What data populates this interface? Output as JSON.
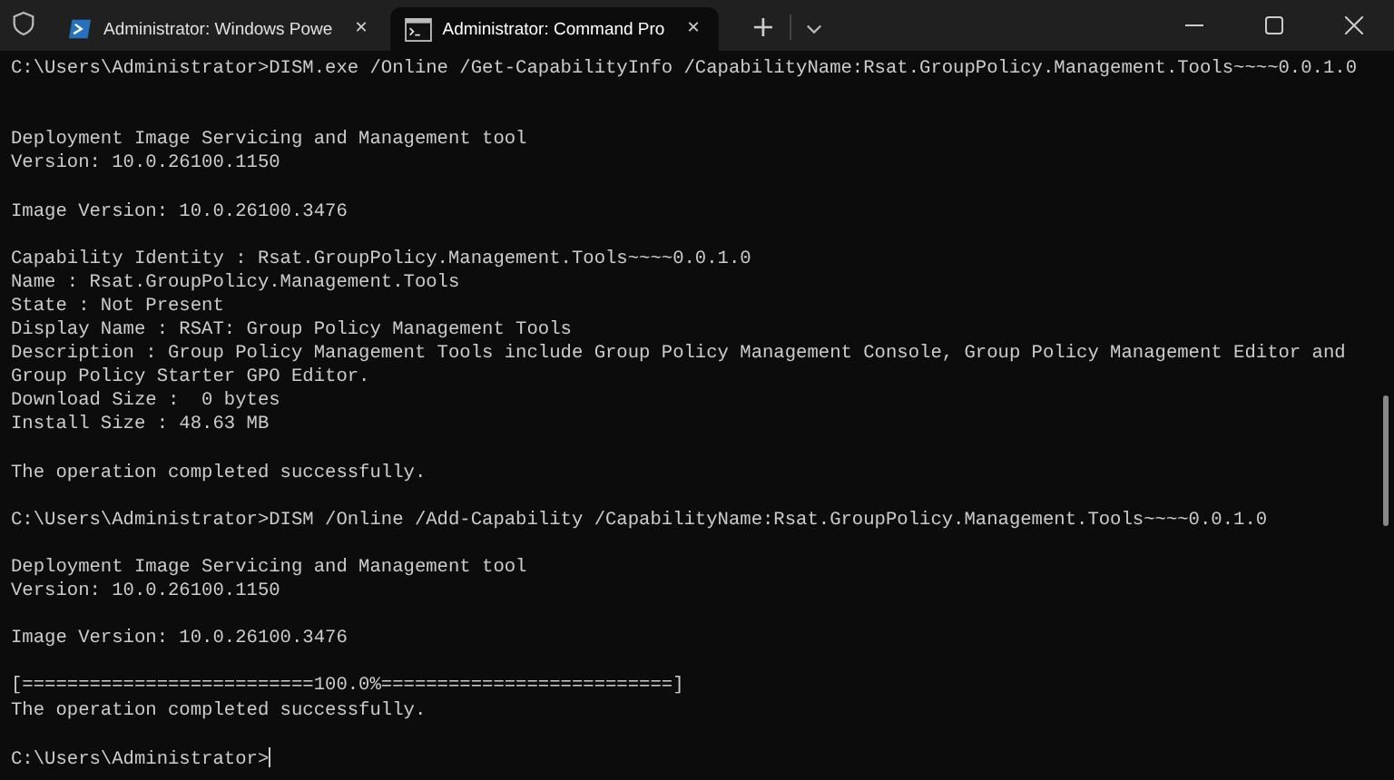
{
  "tabs": [
    {
      "title": "Administrator: Windows Powe",
      "kind": "powershell",
      "selected": false,
      "close": "✕"
    },
    {
      "title": "Administrator: Command Pro",
      "kind": "cmd",
      "selected": true,
      "close": "✕"
    }
  ],
  "new_tab": "+",
  "terminal": {
    "lines": [
      {
        "kind": "text",
        "text": "C:\\Users\\Administrator>DISM.exe /Online /Get-CapabilityInfo /CapabilityName:Rsat.GroupPolicy.Management.Tools~~~~0.0.1.0"
      },
      {
        "kind": "blank"
      },
      {
        "kind": "blank"
      },
      {
        "kind": "text",
        "text": "Deployment Image Servicing and Management tool"
      },
      {
        "kind": "text",
        "text": "Version: 10.0.26100.1150"
      },
      {
        "kind": "blank"
      },
      {
        "kind": "text",
        "text": "Image Version: 10.0.26100.3476"
      },
      {
        "kind": "blank"
      },
      {
        "kind": "text",
        "text": "Capability Identity : Rsat.GroupPolicy.Management.Tools~~~~0.0.1.0"
      },
      {
        "kind": "text",
        "text": "Name : Rsat.GroupPolicy.Management.Tools"
      },
      {
        "kind": "text",
        "text": "State : Not Present"
      },
      {
        "kind": "text",
        "text": "Display Name : RSAT: Group Policy Management Tools"
      },
      {
        "kind": "text",
        "text": "Description : Group Policy Management Tools include Group Policy Management Console, Group Policy Management Editor and"
      },
      {
        "kind": "text",
        "text": "Group Policy Starter GPO Editor."
      },
      {
        "kind": "text",
        "text": "Download Size :  0 bytes"
      },
      {
        "kind": "text",
        "text": "Install Size : 48.63 MB"
      },
      {
        "kind": "blank"
      },
      {
        "kind": "text",
        "text": "The operation completed successfully."
      },
      {
        "kind": "blank"
      },
      {
        "kind": "text",
        "text": "C:\\Users\\Administrator>DISM /Online /Add-Capability /CapabilityName:Rsat.GroupPolicy.Management.Tools~~~~0.0.1.0"
      },
      {
        "kind": "blank"
      },
      {
        "kind": "text",
        "text": "Deployment Image Servicing and Management tool"
      },
      {
        "kind": "text",
        "text": "Version: 10.0.26100.1150"
      },
      {
        "kind": "blank"
      },
      {
        "kind": "text",
        "text": "Image Version: 10.0.26100.3476"
      },
      {
        "kind": "blank"
      },
      {
        "kind": "text",
        "text": "[==========================100.0%==========================]"
      },
      {
        "kind": "text",
        "text": "The operation completed successfully."
      },
      {
        "kind": "blank"
      },
      {
        "kind": "prompt",
        "text": "C:\\Users\\Administrator>"
      }
    ]
  }
}
